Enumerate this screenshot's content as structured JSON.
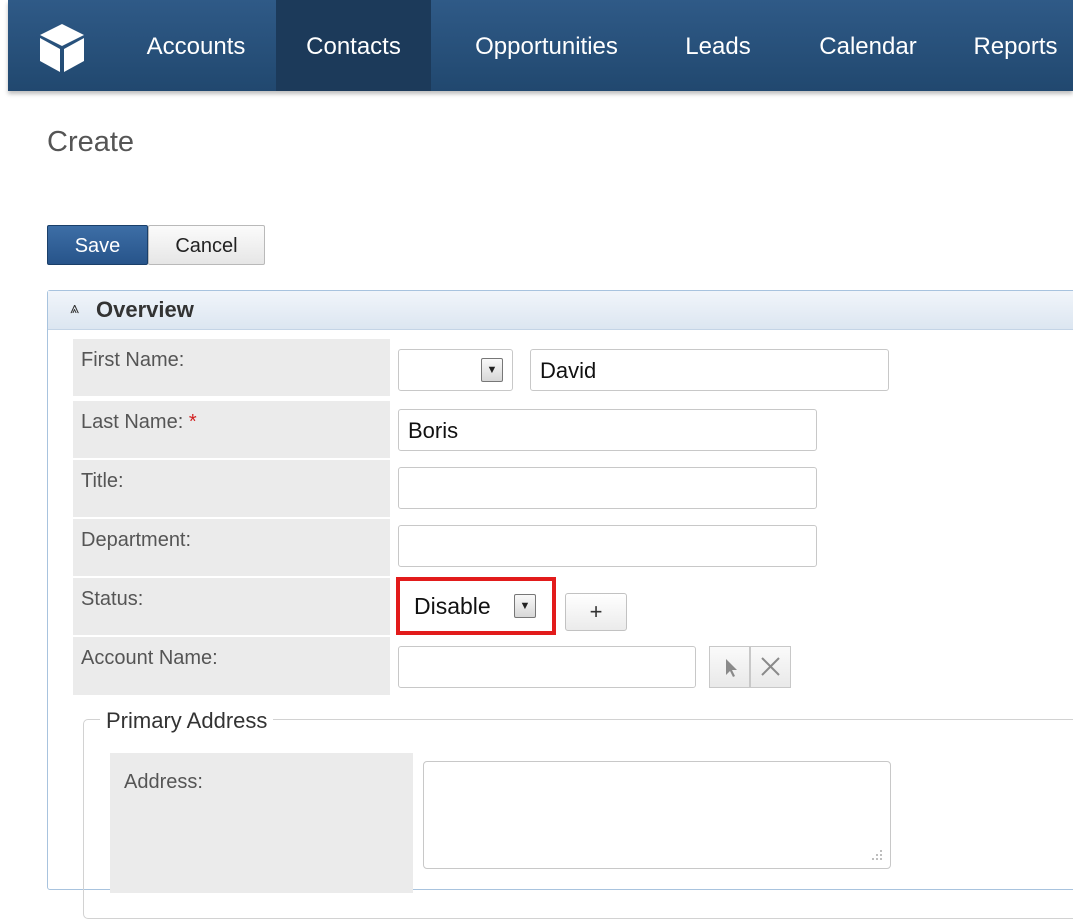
{
  "nav": {
    "items": [
      "Accounts",
      "Contacts",
      "Opportunities",
      "Leads",
      "Calendar",
      "Reports"
    ],
    "active": "Contacts"
  },
  "page": {
    "title": "Create"
  },
  "toolbar": {
    "save_label": "Save",
    "cancel_label": "Cancel"
  },
  "panel": {
    "title": "Overview",
    "toggle_icon": "⩓"
  },
  "form": {
    "first_name": {
      "label": "First Name:",
      "salutation": "",
      "value": "David"
    },
    "last_name": {
      "label": "Last Name:",
      "required_mark": "*",
      "value": "Boris"
    },
    "title": {
      "label": "Title:",
      "value": ""
    },
    "department": {
      "label": "Department:",
      "value": ""
    },
    "status": {
      "label": "Status:",
      "value": "Disable",
      "add_label": "+"
    },
    "account_name": {
      "label": "Account Name:",
      "value": ""
    }
  },
  "address": {
    "legend": "Primary Address",
    "address_label": "Address:",
    "address_value": ""
  },
  "colors": {
    "nav_bg": "#2b5480",
    "nav_active": "#1c3a5a",
    "save_button": "#2f5f96",
    "highlight": "#e21b1b",
    "required": "#d21f1f"
  },
  "icons": [
    "cube-logo-icon",
    "double-chevron-up-icon",
    "dropdown-arrow-icon",
    "select-cursor-icon",
    "clear-x-icon",
    "resize-grip-icon"
  ]
}
